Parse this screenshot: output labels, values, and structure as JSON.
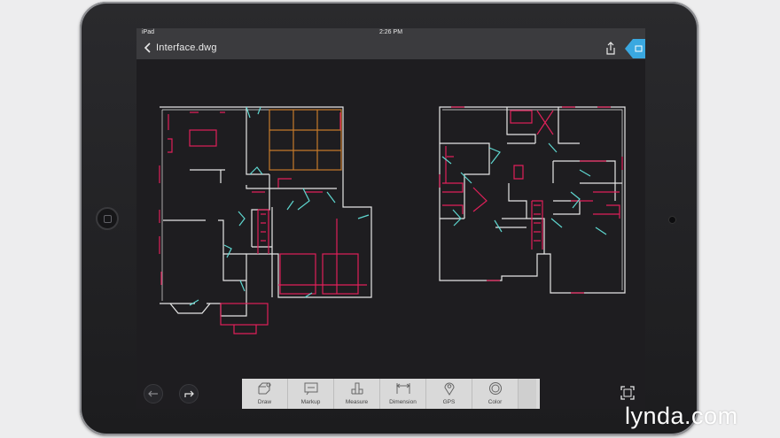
{
  "status_bar": {
    "device": "iPad",
    "time": "2:26 PM"
  },
  "titlebar": {
    "filename": "Interface.dwg"
  },
  "toolbar": {
    "tools": [
      {
        "label": "Draw",
        "icon": "draw-icon"
      },
      {
        "label": "Markup",
        "icon": "markup-icon"
      },
      {
        "label": "Measure",
        "icon": "measure-icon"
      },
      {
        "label": "Dimension",
        "icon": "dimension-icon"
      },
      {
        "label": "GPS",
        "icon": "gps-icon"
      },
      {
        "label": "Color",
        "icon": "color-icon"
      }
    ]
  },
  "colors": {
    "wall": "#e6e6e6",
    "detail": "#e0205a",
    "door": "#5fd7d0",
    "accent": "#3aa8e0",
    "furniture": "#c57a2a"
  },
  "watermark": "lynda.com"
}
